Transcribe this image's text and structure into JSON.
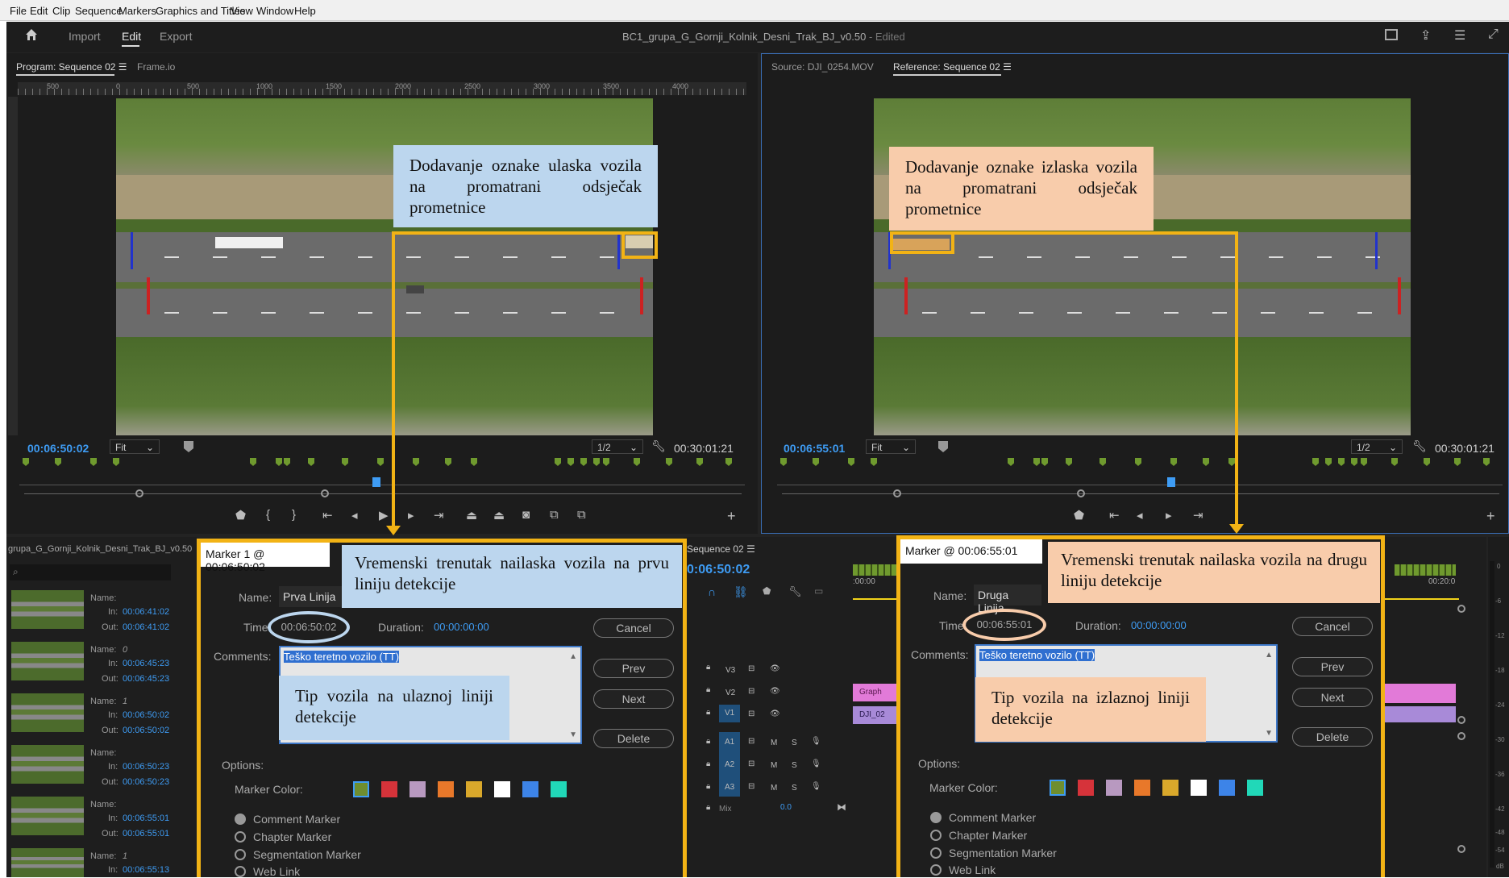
{
  "menu": [
    "File",
    "Edit",
    "Clip",
    "Sequence",
    "Markers",
    "Graphics and Titles",
    "View",
    "Window",
    "Help"
  ],
  "header": {
    "tabs": [
      "Import",
      "Edit",
      "Export"
    ],
    "active": "Edit",
    "title": "BC1_grupa_G_Gornji_Kolnik_Desni_Trak_BJ_v0.50",
    "edited": "- Edited"
  },
  "program": {
    "tab": "Program: Sequence 02",
    "tab2": "Frame.io",
    "ruler": [
      "500",
      "0",
      "500",
      "1000",
      "1500",
      "2000",
      "2500",
      "3000",
      "3500",
      "4000"
    ],
    "timecode": "00:06:50:02",
    "fit": "Fit",
    "res": "1/2",
    "duration": "00:30:01:21"
  },
  "source": {
    "tab": "Source: DJI_0254.MOV",
    "tab2": "Reference: Sequence 02",
    "timecode": "00:06:55:01",
    "fit": "Fit",
    "res": "1/2",
    "duration": "00:30:01:21"
  },
  "project": {
    "title": "grupa_G_Gornji_Kolnik_Desni_Trak_BJ_v0.50",
    "items": [
      {
        "name": "",
        "in": "00:06:41:02",
        "out": "00:06:41:02"
      },
      {
        "name": "0",
        "in": "00:06:45:23",
        "out": "00:06:45:23"
      },
      {
        "name": "1",
        "in": "00:06:50:02",
        "out": "00:06:50:02"
      },
      {
        "name": "",
        "in": "00:06:50:23",
        "out": "00:06:50:23"
      },
      {
        "name": "",
        "in": "00:06:55:01",
        "out": "00:06:55:01"
      },
      {
        "name": "1",
        "in": "00:06:55:13",
        "out": ""
      }
    ],
    "labels": {
      "name": "Name:",
      "in": "In:",
      "out": "Out:"
    }
  },
  "timeline": {
    "tab": "Sequence 02",
    "timecode": "0:06:50:02",
    "ruler_start": ":00:00",
    "ruler_end": "00:20:0",
    "tracks": [
      "V3",
      "V2",
      "V1",
      "A1",
      "A2",
      "A3",
      "Mix"
    ],
    "mix_value": "0.0",
    "clip1": "Graph",
    "clip2": "DJI_02"
  },
  "meter": {
    "scale": [
      "0",
      "-6",
      "-12",
      "-18",
      "-24",
      "-30",
      "-36",
      "-42",
      "-48",
      "-54",
      "dB"
    ]
  },
  "dialog1": {
    "title": "Marker 1 @ 00:06:50:02",
    "name_label": "Name:",
    "name": "Prva Linija",
    "time_label": "Time:",
    "time": "00:06:50:02",
    "duration_label": "Duration:",
    "duration": "00:00:00:00",
    "comments_label": "Comments:",
    "comment": "Teško teretno vozilo (TT)",
    "buttons": [
      "Cancel",
      "Prev",
      "Next",
      "Delete"
    ],
    "options": "Options:",
    "marker_color": "Marker Color:",
    "radios": [
      "Comment Marker",
      "Chapter Marker",
      "Segmentation Marker",
      "Web Link"
    ]
  },
  "dialog2": {
    "title": "Marker @ 00:06:55:01",
    "name_label": "Name:",
    "name": "Druga Linija",
    "time_label": "Time:",
    "time": "00:06:55:01",
    "duration_label": "Duration:",
    "duration": "00:00:00:00",
    "comments_label": "Comments:",
    "comment": "Teško teretno vozilo (TT)",
    "buttons": [
      "Cancel",
      "Prev",
      "Next",
      "Delete"
    ],
    "options": "Options:",
    "marker_color": "Marker Color:",
    "radios": [
      "Comment Marker",
      "Chapter Marker",
      "Segmentation Marker",
      "Web Link"
    ]
  },
  "swatches": [
    "#6f8e2f",
    "#d6333a",
    "#b899c0",
    "#e8782a",
    "#d9a82b",
    "#ffffff",
    "#3d84e8",
    "#21d8b8"
  ],
  "callouts": {
    "c1": "Dodavanje oznake ulaska vozila na promatrani odsječak prometnice",
    "c2": "Dodavanje oznake izlaska vozila na promatrani odsječak prometnice",
    "c3": "Vremenski trenutak nailaska vozila na prvu liniju detekcije",
    "c4": "Vremenski trenutak nailaska vozila na drugu liniju detekcije",
    "c5": "Tip vozila na ulaznoj liniji detekcije",
    "c6": "Tip vozila na izlaznoj liniji detekcije"
  },
  "colors": {
    "accent": "#f2b315",
    "timecode": "#3e9cf4",
    "callout_blue": "#bcd6ee",
    "callout_peach": "#f8ccab"
  },
  "icons": [
    "home-icon",
    "wrench-icon",
    "play-icon",
    "step-back-icon",
    "step-forward-icon",
    "go-to-in-icon",
    "go-to-out-icon",
    "camera-icon",
    "add-icon",
    "magnet-icon",
    "lock-icon",
    "eye-icon",
    "microphone-icon"
  ]
}
